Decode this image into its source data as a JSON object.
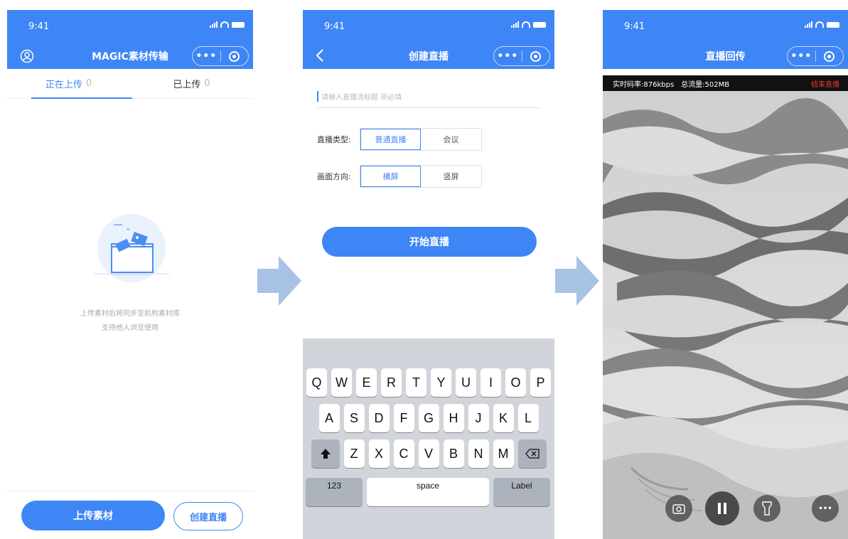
{
  "phone1": {
    "status_time": "9:41",
    "nav_title": "MAGIC素材传输",
    "tabs": [
      {
        "label": "正在上传",
        "count": "0"
      },
      {
        "label": "已上传",
        "count": "0"
      }
    ],
    "empty_lines": [
      "上传素材后将同步至机构素材库",
      "支持他人浏览使用"
    ],
    "upload_button": "上传素材",
    "create_button": "创建直播"
  },
  "phone2": {
    "status_time": "9:41",
    "nav_title": "创建直播",
    "title_placeholder": "请输入直播流标题  非必填",
    "type_label": "直播类型:",
    "type_options": [
      "普通直播",
      "会议"
    ],
    "orient_label": "画面方向:",
    "orient_options": [
      "横屏",
      "竖屏"
    ],
    "start_button": "开始直播",
    "keyboard": {
      "row1": [
        "Q",
        "W",
        "E",
        "R",
        "T",
        "Y",
        "U",
        "I",
        "O",
        "P"
      ],
      "row2": [
        "A",
        "S",
        "D",
        "F",
        "G",
        "H",
        "J",
        "K",
        "L"
      ],
      "row3": [
        "Z",
        "X",
        "C",
        "V",
        "B",
        "N",
        "M"
      ],
      "k123": "123",
      "space": "space",
      "label": "Label"
    }
  },
  "phone3": {
    "status_time": "9:41",
    "nav_title": "直播回传",
    "bitrate": "实时码率:876kbps",
    "traffic": "总流量:502MB",
    "end_button": "结束直播"
  },
  "colors": {
    "accent": "#3e86f5",
    "end_red": "#e53935",
    "arrow": "#a8c2e6"
  },
  "icons": [
    "user-icon",
    "more-icon",
    "target-icon",
    "back-icon",
    "shift-icon",
    "backspace-icon",
    "switch-camera-icon",
    "pause-icon",
    "flashlight-icon"
  ]
}
